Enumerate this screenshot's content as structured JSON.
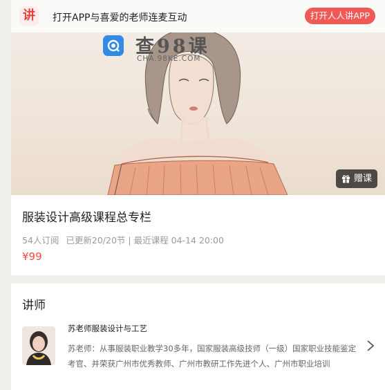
{
  "topbar": {
    "logo_char": "讲",
    "promo_text": "打开APP与喜爱的老师连麦互动",
    "open_app_label": "打开人人讲APP"
  },
  "banner": {
    "watermark_title": "查98课",
    "watermark_sub": "CHA.98KE.COM",
    "gift_label": "赠课"
  },
  "course": {
    "title": "服装设计高级课程总专栏",
    "subscribers": "54人订阅",
    "updated": "已更新20/20节",
    "latest": "| 最近课程 04-14 20:00",
    "price": "¥99"
  },
  "teacher_section": {
    "title": "讲师",
    "name": "苏老师服装设计与工艺",
    "bio": "苏老师：从事服装职业教学30多年，国家服装高级技师（一级）国家职业技能鉴定考官、并荣获广州市优秀教师、广州市教研工作先进个人、广州市职业培训"
  },
  "colors": {
    "accent": "#ef5a57",
    "price": "#ee4b47",
    "background": "#f1efec"
  },
  "icons": {
    "logo": "ren-ren-jiang-logo-icon",
    "watermark": "cha98ke-logo-icon",
    "gift": "gift-icon",
    "chevron": "chevron-right-icon"
  }
}
